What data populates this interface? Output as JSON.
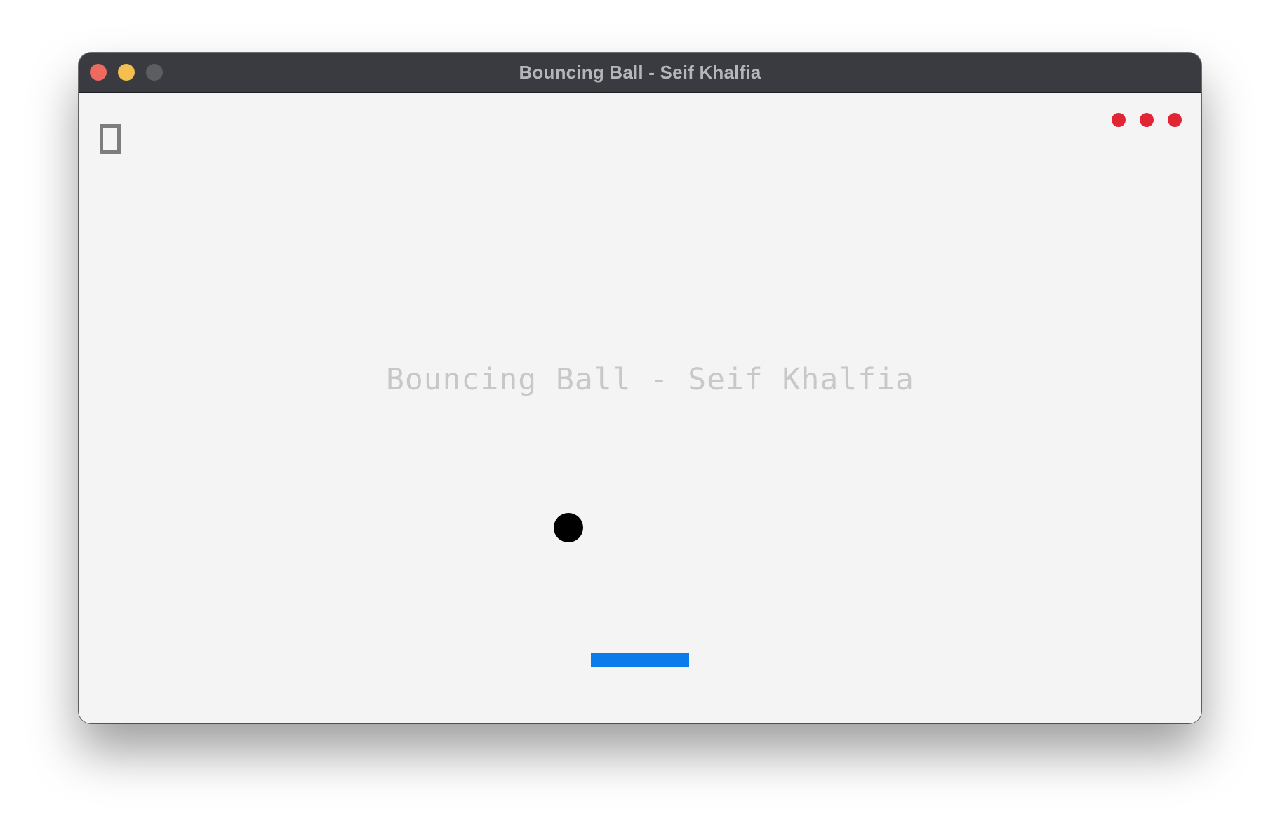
{
  "window": {
    "title": "Bouncing Ball - Seif Khalfia"
  },
  "colors": {
    "close": "#ec6a5e",
    "minimize": "#f4bf4f",
    "maximize": "#5d5e62",
    "ball": "#000000",
    "paddle": "#0a7bea",
    "life": "#e12535"
  },
  "game": {
    "watermark": "Bouncing Ball - Seif Khalfia",
    "score": "0",
    "lives": 3
  }
}
